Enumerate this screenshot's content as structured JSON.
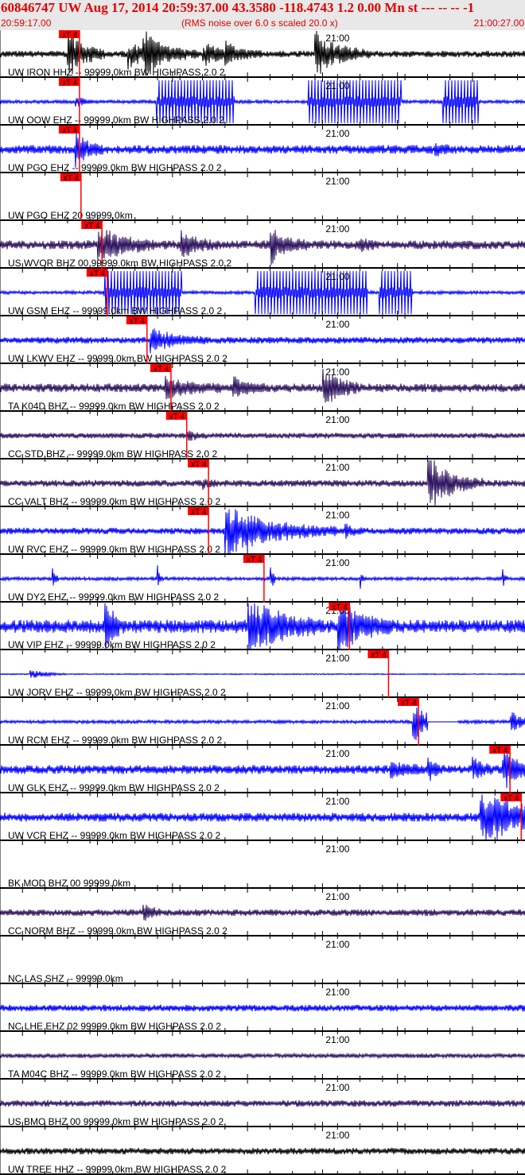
{
  "header": {
    "title": "60846747 UW Aug 17, 2014 20:59:37.00   43.3580 -118.4743  1.2 0.00 Mn st --- -- --  -1",
    "start_time": "20:59:17.00",
    "note": "(RMS noise over 6.0 s scaled 20.0 x)",
    "end_time": "21:00:27.00"
  },
  "chart_data": {
    "type": "line",
    "title": "60846747 UW Aug 17, 2014 20:59:37.00",
    "x_range": [
      "20:59:17.00",
      "21:00:27.00"
    ],
    "x_tick_label": "21:00",
    "pick_label": "xT 4",
    "colors": {
      "black": "#000000",
      "blue": "#0000ff",
      "purple": "#2b0f5c",
      "pick": "#ff0000",
      "header_text": "#e00000"
    },
    "traces": [
      {
        "label": "UW IRON HHZ -- 99999.0km BW  HIGHPASS  2.0  2",
        "color": "black",
        "pick": "20:59:27.6"
      },
      {
        "label": "UW OOW EHZ -- 99999.0km BW  HIGHPASS  2.0  2",
        "color": "blue",
        "pick": "20:59:27.6"
      },
      {
        "label": "UW PGO EHZ -- 99999.0km BW  HIGHPASS  2.0  2",
        "color": "blue",
        "pick": "20:59:27.6"
      },
      {
        "label": "UW PGO EHZ 20 99999.0km",
        "color": "blue",
        "pick": "20:59:27.8"
      },
      {
        "label": "US WVOR BHZ 00 99999.0km BW  HIGHPASS  2.0  2",
        "color": "purple",
        "pick": "20:59:30.6"
      },
      {
        "label": "UW GSM EHZ -- 99999.0km BW  HIGHPASS  2.0  2",
        "color": "blue",
        "pick": "20:59:31.3"
      },
      {
        "label": "UW LKWV EHZ -- 99999.0km BW  HIGHPASS  2.0  2",
        "color": "blue",
        "pick": "20:59:36.6"
      },
      {
        "label": "TA K04D BHZ -- 99999.0km BW  HIGHPASS  2.0  2",
        "color": "purple",
        "pick": "20:59:39.8"
      },
      {
        "label": "CC STD BHZ -- 99999.0km BW  HIGHPASS  2.0  2",
        "color": "purple",
        "pick": "20:59:41.9"
      },
      {
        "label": "CC VALT BHZ -- 99999.0km BW  HIGHPASS  2.0  2",
        "color": "purple",
        "pick": "20:59:44.8"
      },
      {
        "label": "UW RVC EHZ -- 99999.0km BW  HIGHPASS  2.0  2",
        "color": "blue",
        "pick": "20:59:44.8"
      },
      {
        "label": "UW DY2 EHZ -- 99999.0km BW  HIGHPASS  2.0  2",
        "color": "blue",
        "pick": "20:59:52.2"
      },
      {
        "label": "UW VIP EHZ -- 99999.0km BW  HIGHPASS  2.0  2",
        "color": "blue",
        "pick": "21:00:03.6"
      },
      {
        "label": "UW JORV EHZ -- 99999.0km BW  HIGHPASS  2.0  2",
        "color": "blue",
        "pick": "21:00:08.8"
      },
      {
        "label": "UW RCM EHZ -- 99999.0km BW  HIGHPASS  2.0  2",
        "color": "blue",
        "pick": "21:00:12.8"
      },
      {
        "label": "UW GLK EHZ -- 99999.0km BW  HIGHPASS  2.0  2",
        "color": "blue",
        "pick": "21:00:25.0"
      },
      {
        "label": "UW VCR EHZ -- 99999.0km BW  HIGHPASS  2.0  2",
        "color": "blue",
        "pick": "21:00:26.5"
      },
      {
        "label": "BK MOD BHZ 00 99999.0km",
        "color": "purple",
        "pick": null
      },
      {
        "label": "CC NORM BHZ -- 99999.0km BW  HIGHPASS  2.0  2",
        "color": "purple",
        "pick": null
      },
      {
        "label": "NC LAS SHZ -- 99999.0km",
        "color": "blue",
        "pick": null
      },
      {
        "label": "NC LHE EHZ 02 99999.0km BW  HIGHPASS  2.0  2",
        "color": "blue",
        "pick": null
      },
      {
        "label": "TA M04C BHZ -- 99999.0km BW  HIGHPASS  2.0  2",
        "color": "purple",
        "pick": null
      },
      {
        "label": "US BMO BHZ 00 99999.0km BW  HIGHPASS  2.0  2",
        "color": "purple",
        "pick": null
      },
      {
        "label": "UW TREE HHZ -- 99999.0km BW  HIGHPASS  2.0  2",
        "color": "black",
        "pick": null
      }
    ]
  }
}
